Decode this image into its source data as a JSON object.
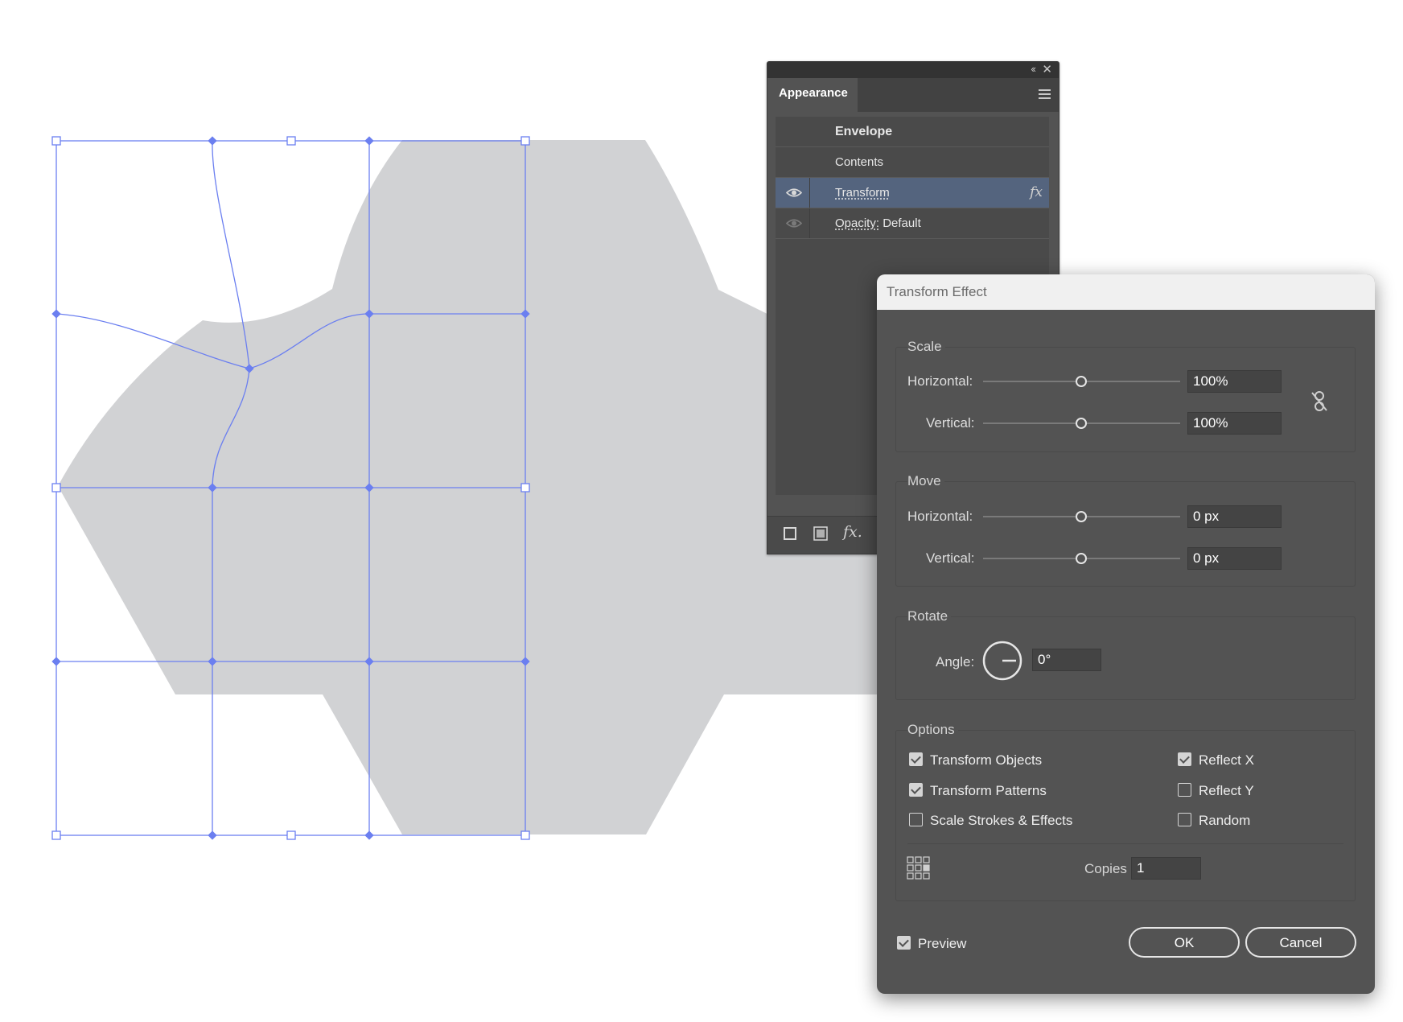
{
  "appearance_panel": {
    "tab_label": "Appearance",
    "collapse_label": "‹‹",
    "close_label": "✕",
    "rows": [
      {
        "label": "Envelope",
        "value": ""
      },
      {
        "label": "Contents",
        "value": ""
      },
      {
        "label": "Transform",
        "value": "",
        "fx": "fx"
      },
      {
        "label": "Opacity:",
        "value": "Default"
      }
    ],
    "bottom_fx_label": "fx."
  },
  "transform_dialog": {
    "title": "Transform Effect",
    "scale": {
      "label": "Scale",
      "horizontal_label": "Horizontal:",
      "horizontal_value": "100%",
      "vertical_label": "Vertical:",
      "vertical_value": "100%"
    },
    "move": {
      "label": "Move",
      "horizontal_label": "Horizontal:",
      "horizontal_value": "0 px",
      "vertical_label": "Vertical:",
      "vertical_value": "0 px"
    },
    "rotate": {
      "label": "Rotate",
      "angle_label": "Angle:",
      "angle_value": "0°"
    },
    "options": {
      "label": "Options",
      "transform_objects": {
        "label": "Transform Objects",
        "checked": true
      },
      "transform_patterns": {
        "label": "Transform Patterns",
        "checked": true
      },
      "scale_strokes": {
        "label": "Scale Strokes & Effects",
        "checked": false
      },
      "reflect_x": {
        "label": "Reflect X",
        "checked": true
      },
      "reflect_y": {
        "label": "Reflect Y",
        "checked": false
      },
      "random": {
        "label": "Random",
        "checked": false
      },
      "copies_label": "Copies",
      "copies_value": "1"
    },
    "preview": {
      "label": "Preview",
      "checked": true
    },
    "ok_label": "OK",
    "cancel_label": "Cancel"
  },
  "colors": {
    "envelope_mesh": "#6b7ff0",
    "gray_shape": "#d1d2d4",
    "panel_bg": "#535353",
    "selected_row": "#54647e"
  },
  "icons": [
    "eye-icon",
    "fx-icon",
    "menu-icon",
    "link-icon",
    "angle-dial-icon",
    "reference-point-icon"
  ]
}
